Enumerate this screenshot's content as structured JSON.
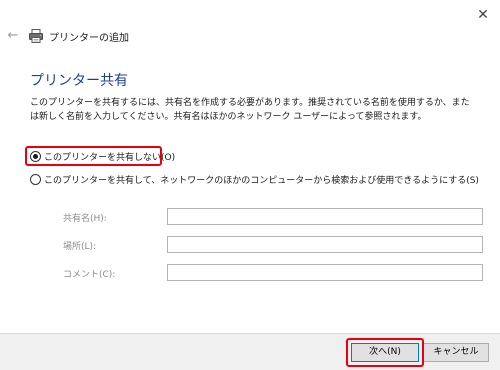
{
  "window": {
    "title": "プリンターの追加",
    "close_glyph": "✕",
    "back_glyph": "←"
  },
  "main": {
    "heading": "プリンター共有",
    "description": "このプリンターを共有するには、共有名を作成する必要があります。推奨されている名前を使用するか、または新しく名前を入力してください。共有名はほかのネットワーク ユーザーによって参照されます。",
    "options": [
      {
        "label": "このプリンターを共有しない(O)",
        "selected": true
      },
      {
        "label": "このプリンターを共有して、ネットワークのほかのコンピューターから検索および使用できるようにする(S)",
        "selected": false
      }
    ],
    "fields": [
      {
        "label": "共有名(H):",
        "value": ""
      },
      {
        "label": "場所(L):",
        "value": ""
      },
      {
        "label": "コメント(C):",
        "value": ""
      }
    ]
  },
  "footer": {
    "next_label": "次へ(N)",
    "cancel_label": "キャンセル"
  },
  "colors": {
    "heading": "#1f3e9c",
    "highlight": "#e8000f",
    "default_button_border": "#0078d7"
  },
  "icons": {
    "back": "back-arrow-icon",
    "printer": "printer-icon",
    "close": "close-icon"
  }
}
